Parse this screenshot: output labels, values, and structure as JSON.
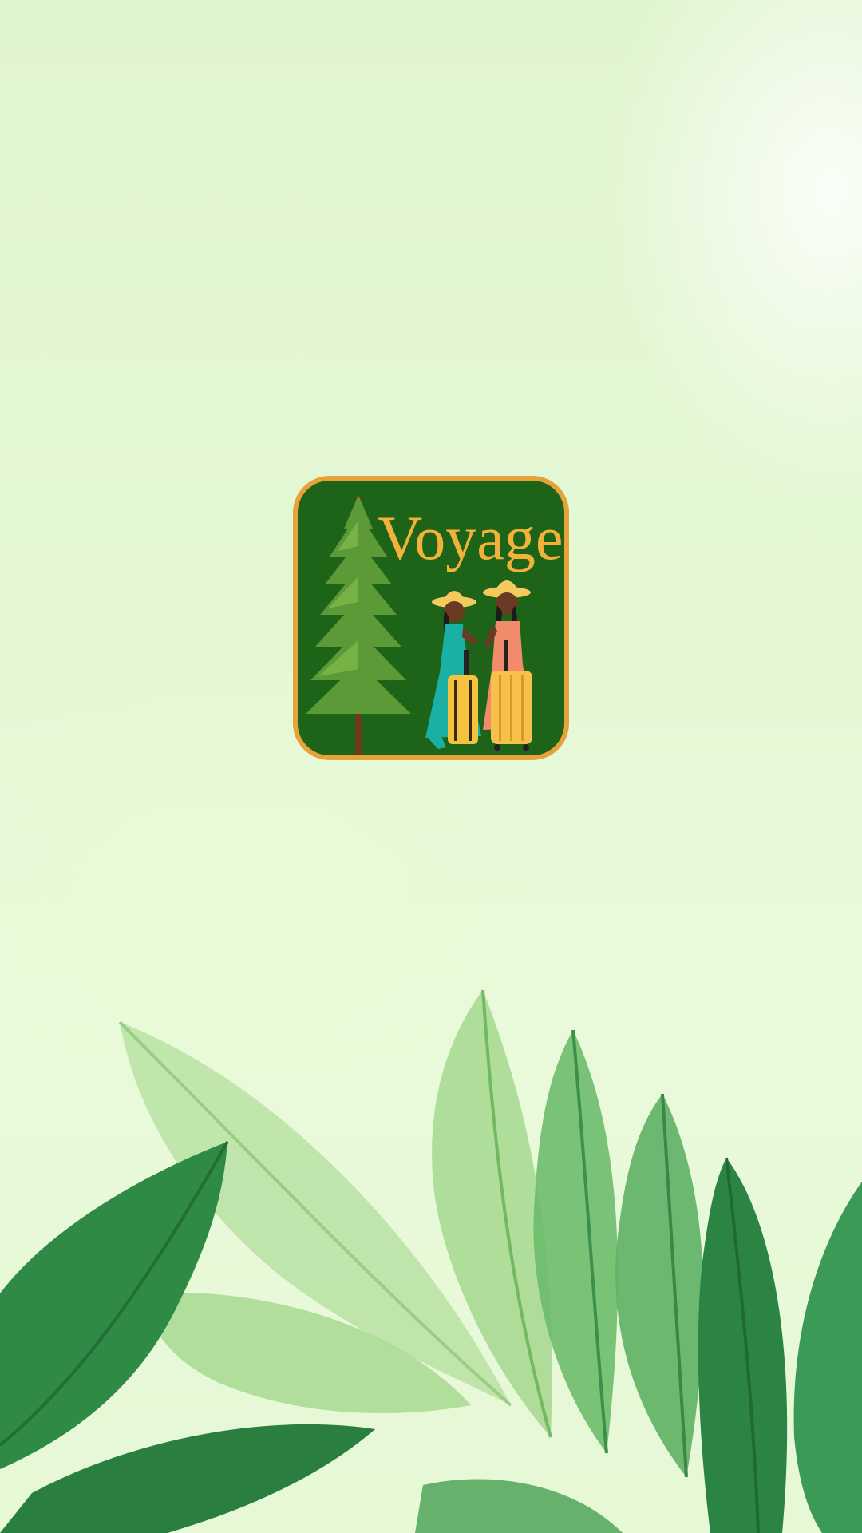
{
  "app": {
    "screen": "splash",
    "logo": {
      "wordmark": "Voyage",
      "icon": "voyage-logo-icon"
    }
  },
  "colors": {
    "background": "#e4f8d5",
    "logo_fill": "#1d6318",
    "logo_border": "#e8a23a",
    "wordmark": "#f2b23a",
    "leaf_dark": "#2f8a45",
    "leaf_light": "#9fd48a"
  }
}
